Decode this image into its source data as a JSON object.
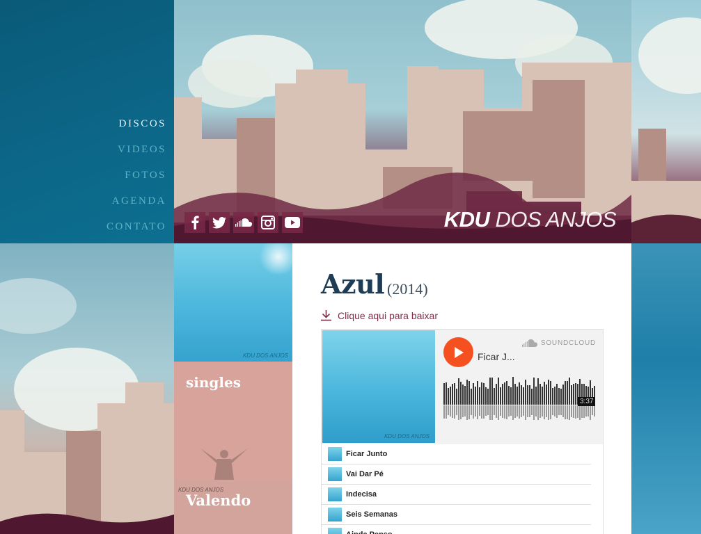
{
  "nav": {
    "items": [
      {
        "label": "DISCOS",
        "active": true
      },
      {
        "label": "VIDEOS",
        "active": false
      },
      {
        "label": "FOTOS",
        "active": false
      },
      {
        "label": "AGENDA",
        "active": false
      },
      {
        "label": "CONTATO",
        "active": false
      }
    ]
  },
  "header": {
    "logo_bold": "KDU",
    "logo_light": "DOS ANJOS",
    "social": [
      "facebook-icon",
      "twitter-icon",
      "soundcloud-icon",
      "instagram-icon",
      "youtube-icon"
    ]
  },
  "albums": {
    "cover_mark": "KDU DOS ANJOS",
    "singles_label": "singles",
    "valendo_label": "Valendo",
    "valendo_mark": "KDU DOS ANJOS"
  },
  "album": {
    "title": "Azul",
    "year": "(2014)",
    "download_label": "Clique aqui para baixar"
  },
  "player": {
    "current_track": "Ficar J...",
    "brand": "SOUNDCLOUD",
    "duration": "3:37",
    "art_mark": "KDU DOS ANJOS",
    "tracks": [
      "Ficar Junto",
      "Vai Dar Pé",
      "Indecisa",
      "Seis Semanas",
      "Ainda Penso"
    ]
  },
  "colors": {
    "nav_bg": "#0c6687",
    "nav_active": "#e9f4f7",
    "nav_item": "#5fb4c6",
    "soundcloud_orange": "#f5501f",
    "title": "#1e3c55",
    "download": "#7a2f4a"
  }
}
